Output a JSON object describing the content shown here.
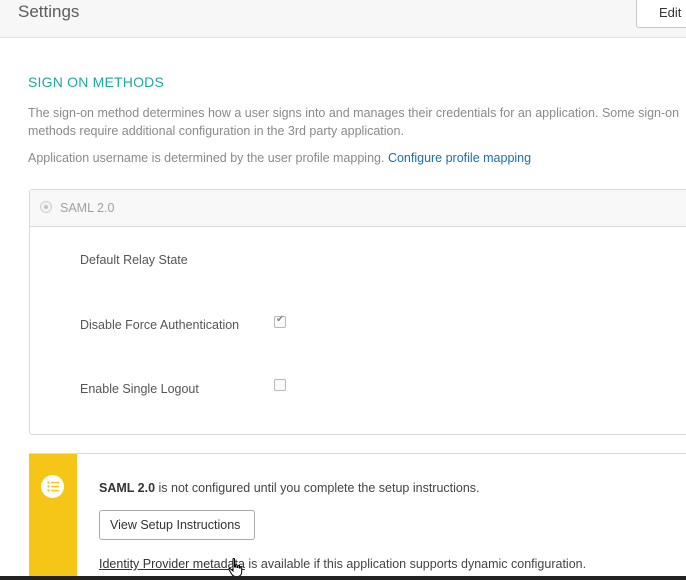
{
  "header": {
    "title": "Settings",
    "edit_label": "Edit"
  },
  "sign_on": {
    "section_title": "SIGN ON METHODS",
    "description": "The sign-on method determines how a user signs into and manages their credentials for an application. Some sign-on methods require additional configuration in the 3rd party application.",
    "username_note": "Application username is determined by the user profile mapping.",
    "profile_link": "Configure profile mapping",
    "method_label": "SAML 2.0",
    "method_selected": true
  },
  "options": {
    "relay_state_label": "Default Relay State",
    "force_auth_label": "Disable Force Authentication",
    "force_auth_checked": true,
    "single_logout_label": "Enable Single Logout",
    "single_logout_checked": false
  },
  "notice": {
    "icon": "list-icon",
    "accent_color": "#f5c518",
    "saml_strong": "SAML 2.0",
    "text": " is not configured until you complete the setup instructions.",
    "button_label": "View Setup Instructions",
    "metadata_link": "Identity Provider metadata",
    "metadata_text": " is available if this application supports dynamic configuration."
  },
  "colors": {
    "section_title": "#1fa7a0",
    "link": "#1d6fa5"
  }
}
